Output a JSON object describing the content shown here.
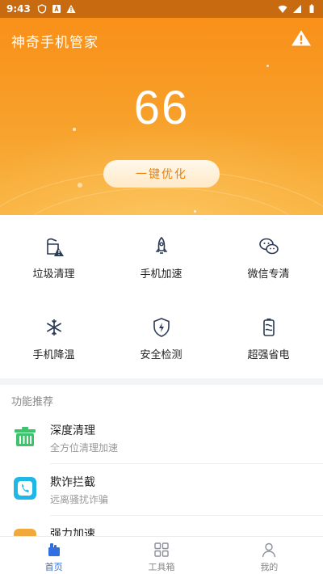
{
  "status_bar": {
    "time": "9:43"
  },
  "app": {
    "title": "神奇手机管家"
  },
  "hero": {
    "score": "66",
    "optimize_label": "一键优化"
  },
  "tools": [
    {
      "label": "垃圾清理",
      "icon": "broom-warning-icon"
    },
    {
      "label": "手机加速",
      "icon": "rocket-icon"
    },
    {
      "label": "微信专清",
      "icon": "wechat-icon"
    },
    {
      "label": "手机降温",
      "icon": "snowflake-icon"
    },
    {
      "label": "安全检测",
      "icon": "shield-bolt-icon"
    },
    {
      "label": "超强省电",
      "icon": "battery-icon"
    }
  ],
  "recommend": {
    "title": "功能推荐",
    "items": [
      {
        "title": "深度清理",
        "subtitle": "全方位清理加速",
        "icon": "trash-bin-icon",
        "color": "#3cc46a"
      },
      {
        "title": "欺诈拦截",
        "subtitle": "远离骚扰诈骗",
        "icon": "phone-shield-icon",
        "color": "#1fb7e6"
      },
      {
        "title": "强力加速",
        "subtitle": "",
        "icon": "boost-icon",
        "color": "#f2a93b"
      }
    ]
  },
  "tabbar": {
    "items": [
      {
        "label": "首页",
        "icon": "home-icon"
      },
      {
        "label": "工具箱",
        "icon": "grid-icon"
      },
      {
        "label": "我的",
        "icon": "person-icon"
      }
    ]
  },
  "colors": {
    "accent": "#f98d16",
    "tab_active": "#2f6fe0",
    "icon_stroke": "#2b3a55"
  }
}
